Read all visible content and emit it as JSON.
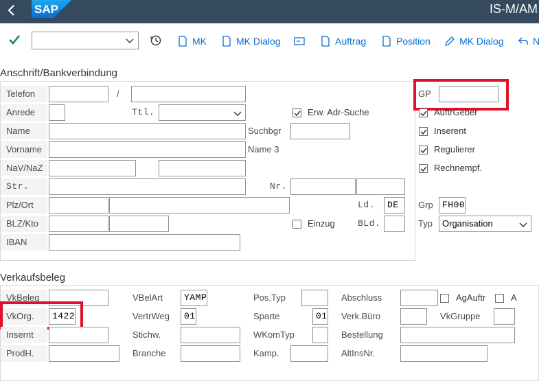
{
  "header": {
    "logo_text": "SAP",
    "app_title": "IS-M/AM"
  },
  "toolbar": {
    "mk": "MK",
    "mk_dialog": "MK Dialog",
    "auftrag": "Auftrag",
    "position": "Position",
    "mk_dialog2": "MK Dialog",
    "next": "N"
  },
  "anschrift": {
    "title": "Anschrift/Bankverbindung",
    "telefon_label": "Telefon",
    "slash": "/",
    "anrede_label": "Anrede",
    "ttl_label": "Ttl.",
    "erw_adr_suche": "Erw. Adr-Suche",
    "name_label": "Name",
    "suchbgr_label": "Suchbgr",
    "vorname_label": "Vorname",
    "name3_label": "Name 3",
    "nav_naz_label": "NaV/NaZ",
    "str_label": "Str.",
    "nr_label": "Nr.",
    "plz_ort_label": "Plz/Ort",
    "ld_label": "Ld.",
    "ld_value": "DE",
    "blz_kto_label": "BLZ/Kto",
    "einzug_label": "Einzug",
    "bld_label": "BLd.",
    "iban_label": "IBAN"
  },
  "gp_panel": {
    "gp_label": "GP",
    "auftraggeber": "AuftrGeber",
    "inserent": "Inserent",
    "regulierer": "Regulierer",
    "rechnempf": "Rechnempf.",
    "grp_label": "Grp",
    "grp_value": "FH00",
    "typ_label": "Typ",
    "typ_value": "Organisation"
  },
  "verkauf": {
    "title": "Verkaufsbeleg",
    "vkbeleg_label": "VkBeleg",
    "vbelart_label": "VBelArt",
    "vbelart_value": "YAMP",
    "postyp_label": "Pos.Typ",
    "abschluss_label": "Abschluss",
    "agauftr_label": "AgAuftr",
    "a_label": "A",
    "vkorg_label": "VkOrg.",
    "vkorg_value": "1422",
    "vertrweg_label": "VertrWeg",
    "vertrweg_value": "01",
    "sparte_label": "Sparte",
    "sparte_value": "01",
    "verkburo_label": "Verk.Büro",
    "vkgruppe_label": "VkGruppe",
    "insernt_label": "Insernt",
    "stichw_label": "Stichw.",
    "wkomtyp_label": "WKomTyp",
    "bestellung_label": "Bestellung",
    "prodh_label": "ProdH.",
    "branche_label": "Branche",
    "kamp_label": "Kamp.",
    "altinsnr_label": "AltInsNr."
  },
  "colors": {
    "shell": "#354a5f",
    "accent": "#0a6ed1",
    "highlight": "#e0102a",
    "confirm": "#107e3e"
  }
}
